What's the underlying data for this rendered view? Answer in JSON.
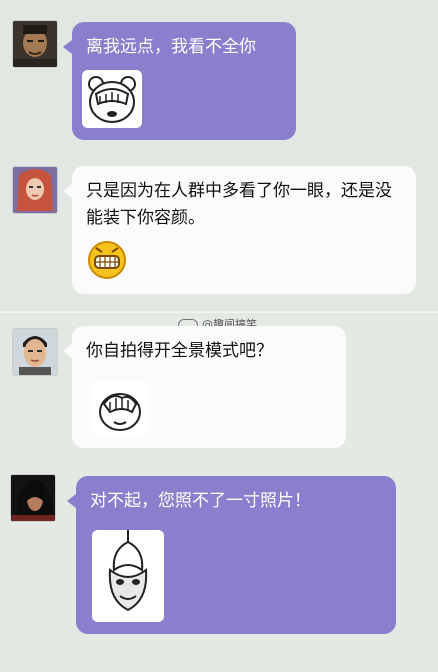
{
  "messages": [
    {
      "text": "离我远点，我看不全你",
      "sticker": "facepalm-bear-sticker"
    },
    {
      "text": "只是因为在人群中多看了你一眼，还是没能装下你容颜。",
      "sticker": "grimace-emoji-sticker"
    },
    {
      "text": "你自拍得开全景模式吧？",
      "sticker": "facepalm-hand-sticker"
    },
    {
      "text": "对不起，您照不了一寸照片！",
      "sticker": "hanging-face-sticker"
    }
  ],
  "watermark": {
    "text": "@趣闻搞笑"
  },
  "colors": {
    "purple_bubble": "#8a7fcc",
    "white_bubble": "#fbfbfb",
    "background": "#e1e8e2"
  }
}
